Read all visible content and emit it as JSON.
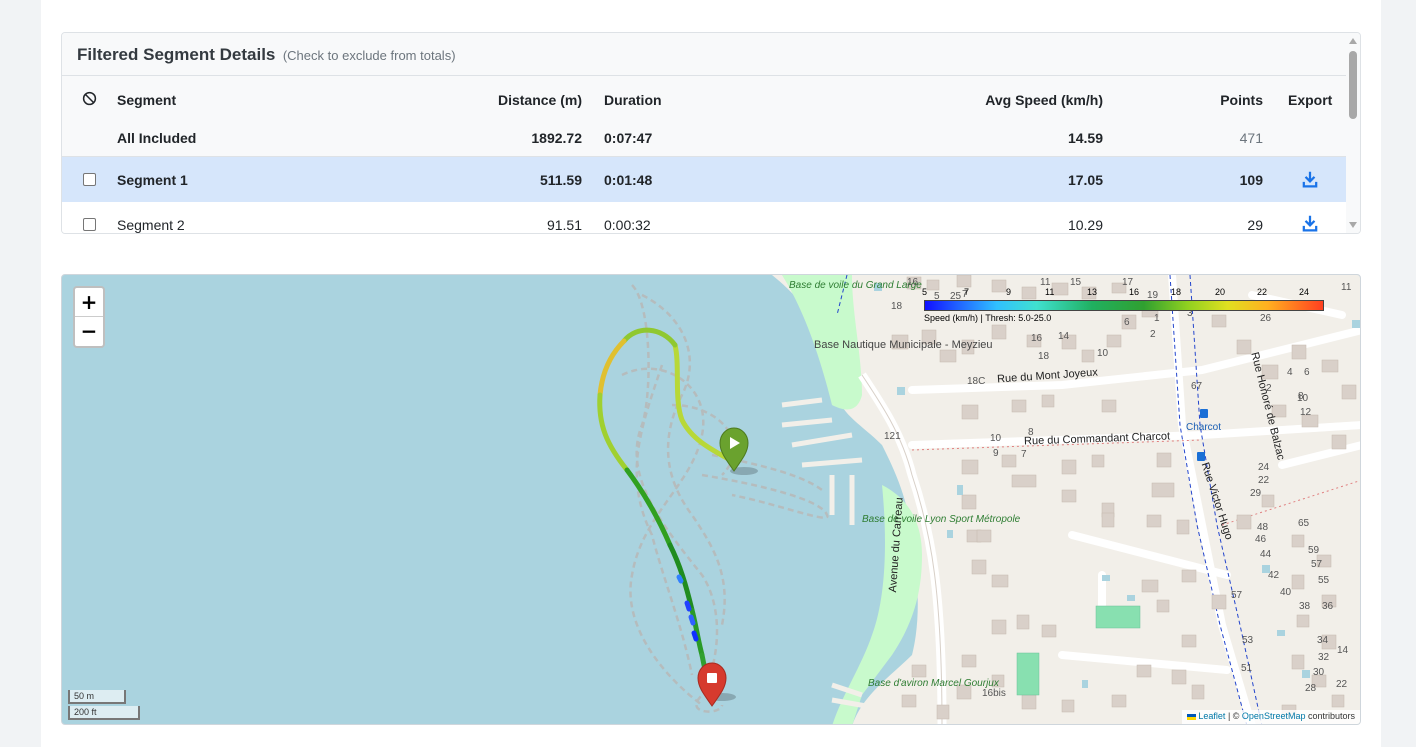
{
  "panel": {
    "title": "Filtered Segment Details",
    "subtitle": "(Check to exclude from totals)"
  },
  "table": {
    "headers": {
      "exclude_icon": "ban-icon",
      "segment": "Segment",
      "distance": "Distance (m)",
      "duration": "Duration",
      "avg_speed": "Avg Speed (km/h)",
      "points": "Points",
      "export": "Export"
    },
    "summary": {
      "label": "All Included",
      "distance": "1892.72",
      "duration": "0:07:47",
      "avg_speed": "14.59",
      "points": "471"
    },
    "rows": [
      {
        "segment": "Segment 1",
        "distance": "511.59",
        "duration": "0:01:48",
        "avg_speed": "17.05",
        "points": "109",
        "checked": false,
        "highlighted": true
      },
      {
        "segment": "Segment 2",
        "distance": "91.51",
        "duration": "0:00:32",
        "avg_speed": "10.29",
        "points": "29",
        "checked": false,
        "highlighted": false
      }
    ]
  },
  "map": {
    "zoom_in": "+",
    "zoom_out": "−",
    "legend": {
      "ticks": [
        "5",
        "7",
        "9",
        "11",
        "13",
        "16",
        "18",
        "20",
        "22",
        "24"
      ],
      "caption": "Speed (km/h) | Thresh: 5.0-25.0"
    },
    "scale": {
      "metric": "50 m",
      "imperial": "200 ft"
    },
    "attribution": {
      "leaflet": "Leaflet",
      "sep": " | © ",
      "osm": "OpenStreetMap",
      "contributors": " contributors"
    },
    "labels": {
      "base_grand_large": "Base de voile du Grand Large",
      "base_nautique": "Base Nautique Municipale - Meyzieu",
      "base_lyon_sport": "Base de voile Lyon Sport Métropole",
      "base_aviron": "Base d'aviron Marcel Gourjux",
      "rue_mont_joyeux": "Rue du Mont Joyeux",
      "rue_commandant": "Rue du Commandant Charcot",
      "avenue_carreau": "Avenue du Carreau",
      "rue_victor_hugo": "Rue Victor Hugo",
      "rue_honore": "Rue Honoré de Balzac",
      "charcot_stop": "Charcot",
      "house_numbers": [
        "16",
        "5",
        "25",
        "7",
        "11",
        "15",
        "17",
        "19",
        "18",
        "3",
        "1",
        "26",
        "11",
        "6",
        "4",
        "2",
        "16",
        "14",
        "18",
        "10",
        "18C",
        "67",
        "4",
        "6",
        "2",
        "8",
        "10",
        "12",
        "121",
        "10",
        "9",
        "8",
        "7",
        "24",
        "22",
        "29",
        "48",
        "65",
        "46",
        "59",
        "44",
        "57",
        "42",
        "55",
        "40",
        "38",
        "36",
        "34",
        "32",
        "30",
        "28",
        "14",
        "22",
        "51",
        "53",
        "57",
        "16bis"
      ]
    }
  }
}
